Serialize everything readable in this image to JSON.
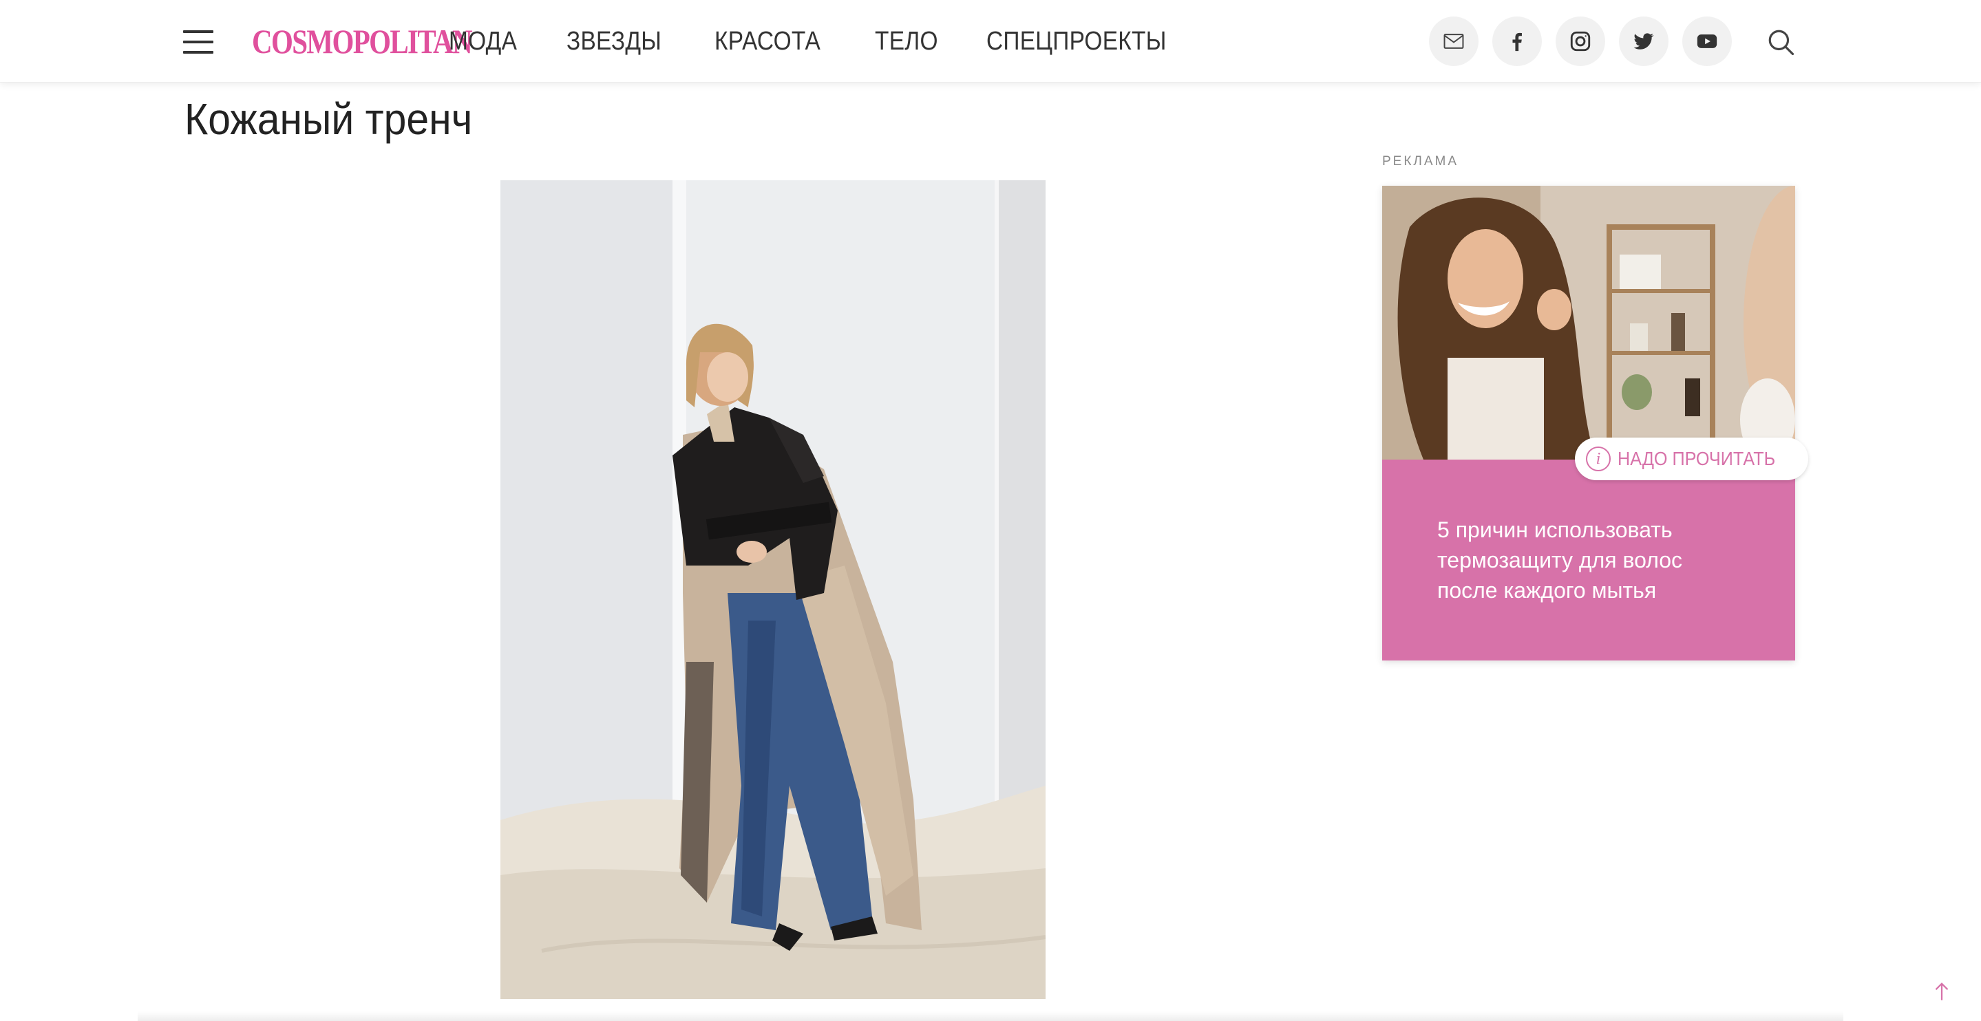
{
  "header": {
    "logo": "COSMOPOLITAN",
    "nav": [
      "МОДА",
      "ЗВЕЗДЫ",
      "КРАСОТА",
      "ТЕЛО",
      "СПЕЦПРОЕКТЫ"
    ],
    "social_icons": [
      "mail-icon",
      "facebook-icon",
      "instagram-icon",
      "twitter-icon",
      "youtube-icon"
    ],
    "search_icon": "search-icon",
    "menu_icon": "hamburger-icon"
  },
  "article": {
    "title": "Кожаный тренч",
    "image_description": "woman in leather trench coat and blue jeans"
  },
  "sidebar": {
    "ad_label": "РЕКЛАМА",
    "ad_badge": "НАДО ПРОЧИТАТЬ",
    "ad_badge_icon": "info-icon",
    "ad_text": "5 причин использовать термозащиту для волос после каждого мытья"
  },
  "colors": {
    "brand_pink": "#e0509d",
    "ad_pink": "#d772a9",
    "text": "#222222"
  },
  "scroll_top_icon": "arrow-up-icon"
}
